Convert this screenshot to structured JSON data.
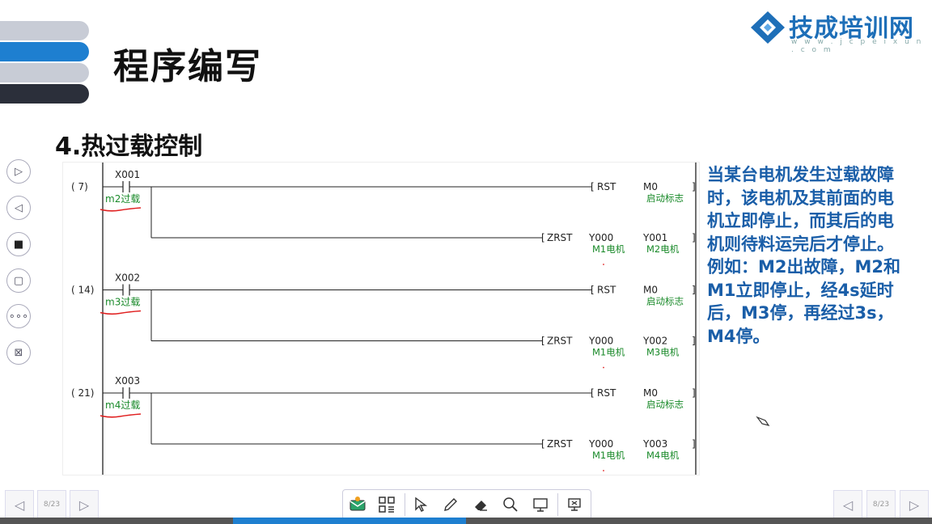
{
  "slide": {
    "title": "程序编写",
    "section": "4.热过载控制",
    "description": "当某台电机发生过载故障时，该电机及其前面的电机立即停止，而其后的电机则待料运完后才停止。例如：M2出故障，M2和M1立即停止，经4s延时后，M3停，再经过3s，M4停。"
  },
  "logo": {
    "name": "技成培训网",
    "url": "w w w . j c p e i x u n . c o m"
  },
  "ladder": {
    "rungs": [
      {
        "step": "(    7)",
        "contact": "X001",
        "comment": "m2过载",
        "rst": "RST",
        "rst_dev": "M0",
        "rst_comment": "启动标志",
        "zrst": "ZRST",
        "dev1": "Y000",
        "dev1_comment": "M1电机",
        "dev2": "Y001",
        "dev2_comment": "M2电机"
      },
      {
        "step": "(   14)",
        "contact": "X002",
        "comment": "m3过载",
        "rst": "RST",
        "rst_dev": "M0",
        "rst_comment": "启动标志",
        "zrst": "ZRST",
        "dev1": "Y000",
        "dev1_comment": "M1电机",
        "dev2": "Y002",
        "dev2_comment": "M3电机"
      },
      {
        "step": "(   21)",
        "contact": "X003",
        "comment": "m4过载",
        "rst": "RST",
        "rst_dev": "M0",
        "rst_comment": "启动标志",
        "zrst": "ZRST",
        "dev1": "Y000",
        "dev1_comment": "M1电机",
        "dev2": "Y003",
        "dev2_comment": "M4电机"
      }
    ]
  },
  "sidebar": {
    "tools": [
      {
        "icon": "play-next-icon",
        "glyph": "▷"
      },
      {
        "icon": "play-prev-icon",
        "glyph": "◁"
      },
      {
        "icon": "eraser-icon",
        "glyph": "■"
      },
      {
        "icon": "screen-select-icon",
        "glyph": "▢"
      },
      {
        "icon": "more-icon",
        "glyph": "∘∘∘"
      },
      {
        "icon": "exit-icon",
        "glyph": "⊠"
      }
    ]
  },
  "footer": {
    "page_left": "8/23",
    "page_right": "8/23",
    "tools": [
      "mail-icon",
      "grid-icon",
      "pointer-icon",
      "pen-icon",
      "eraser-icon",
      "zoom-icon",
      "screen-icon",
      "presentation-icon"
    ]
  },
  "colors": {
    "accent": "#1e7fd0",
    "device_comment": "#1a8a2a",
    "annotation": "#e02020",
    "description": "#1a5ea8"
  }
}
